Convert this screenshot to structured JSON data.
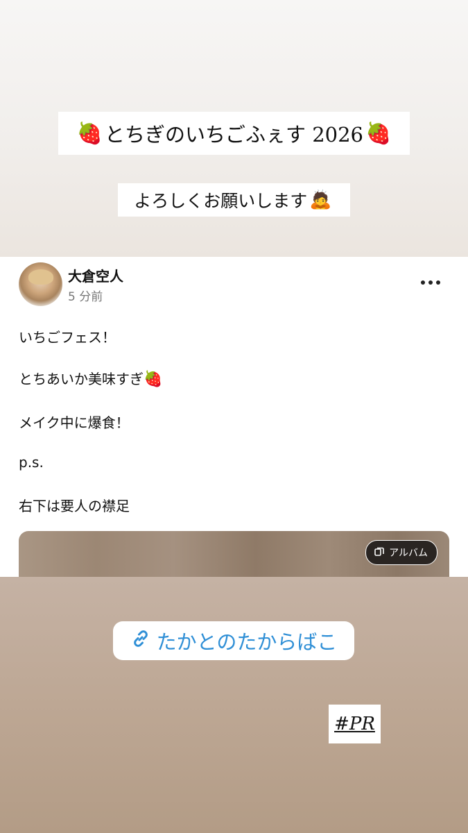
{
  "story": {
    "title": "とちぎのいちごふぇす 2026",
    "subtitle": "よろしくお願いします",
    "title_emoji": "🍓",
    "subtitle_emoji": "🙇",
    "link_sticker": {
      "label": "たかとのたからばこ",
      "icon": "link-icon",
      "color": "#2f8fd6"
    },
    "pr_tag": "#PR"
  },
  "post": {
    "user_name": "大倉空人",
    "time": "5 分前",
    "more_icon": "more-horizontal-icon",
    "lines": [
      "いちごフェス！",
      "とちあいか美味すぎ",
      "メイク中に爆食！",
      "p.s.",
      "右下は要人の襟足"
    ],
    "line2_emoji": "🍓",
    "album_badge": "アルバム"
  }
}
